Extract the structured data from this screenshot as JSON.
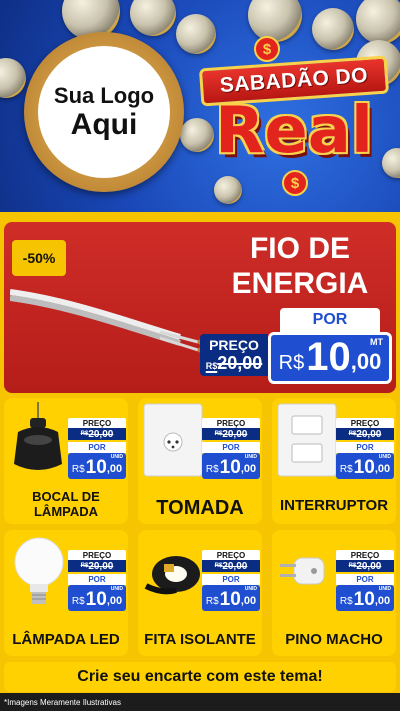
{
  "header": {
    "logo_line1": "Sua Logo",
    "logo_line2": "Aqui",
    "brand_top": "SABADÃO DO",
    "brand_main": "Real",
    "brand_symbol": "$"
  },
  "featured": {
    "discount_badge": "-50%",
    "title_line1": "FIO DE",
    "title_line2": "ENERGIA",
    "price_label": "PREÇO",
    "old_currency": "R$",
    "old_price": "20,00",
    "por_label": "POR",
    "currency": "R$",
    "price_int": "10",
    "price_cents": ",00",
    "unit": "MT"
  },
  "products": [
    {
      "name_l1": "BOCAL DE",
      "name_l2": "LÂMPADA",
      "price_label": "PREÇO",
      "old_currency": "R$",
      "old_price": "20,00",
      "por_label": "POR",
      "currency": "R$",
      "price_int": "10",
      "price_cents": ",00",
      "unit": "UNID"
    },
    {
      "name_l1": "TOMADA",
      "name_l2": "",
      "price_label": "PREÇO",
      "old_currency": "R$",
      "old_price": "20,00",
      "por_label": "POR",
      "currency": "R$",
      "price_int": "10",
      "price_cents": ",00",
      "unit": "UNID"
    },
    {
      "name_l1": "INTERRUPTOR",
      "name_l2": "",
      "price_label": "PREÇO",
      "old_currency": "R$",
      "old_price": "20,00",
      "por_label": "POR",
      "currency": "R$",
      "price_int": "10",
      "price_cents": ",00",
      "unit": "UNID"
    },
    {
      "name_l1": "LÂMPADA LED",
      "name_l2": "",
      "price_label": "PREÇO",
      "old_currency": "R$",
      "old_price": "20,00",
      "por_label": "POR",
      "currency": "R$",
      "price_int": "10",
      "price_cents": ",00",
      "unit": "UNID"
    },
    {
      "name_l1": "FITA ISOLANTE",
      "name_l2": "",
      "price_label": "PREÇO",
      "old_currency": "R$",
      "old_price": "20,00",
      "por_label": "POR",
      "currency": "R$",
      "price_int": "10",
      "price_cents": ",00",
      "unit": "UNID"
    },
    {
      "name_l1": "PINO MACHO",
      "name_l2": "",
      "price_label": "PREÇO",
      "old_currency": "R$",
      "old_price": "20,00",
      "por_label": "POR",
      "currency": "R$",
      "price_int": "10",
      "price_cents": ",00",
      "unit": "UNID"
    }
  ],
  "cta": "Crie seu encarte com este tema!",
  "disclaimer": "*Imagens Meramente Ilustrativas",
  "colors": {
    "background_yellow": "#f6c400",
    "header_blue": "#1a48b8",
    "featured_red": "#cf2d28",
    "price_blue": "#1f4fd0",
    "old_price_navy": "#0a2c82"
  }
}
